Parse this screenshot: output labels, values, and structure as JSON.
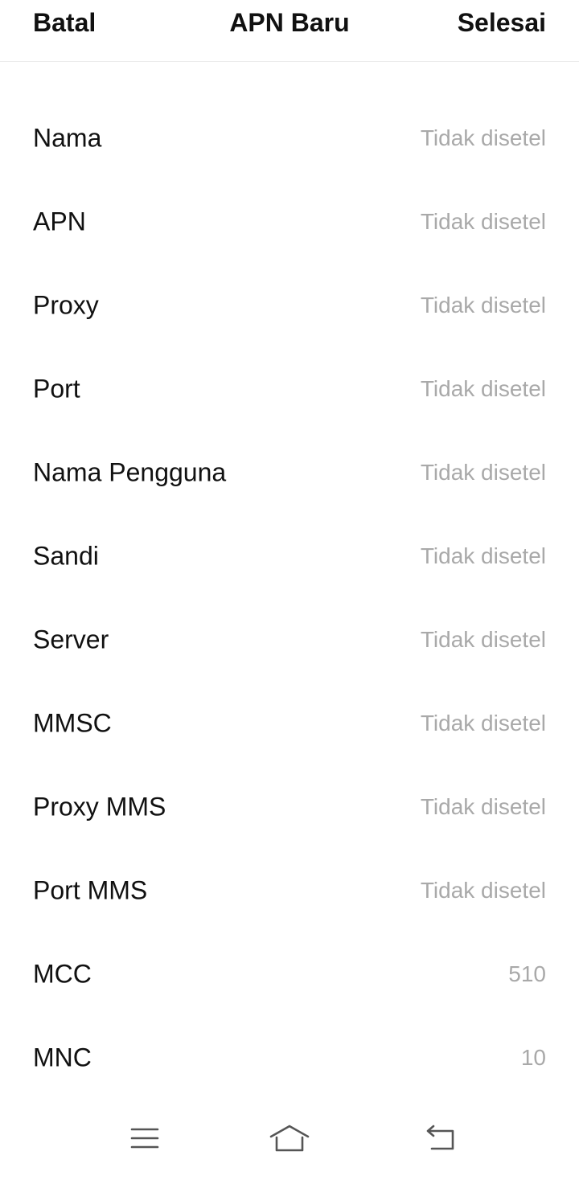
{
  "header": {
    "cancel_label": "Batal",
    "title": "APN Baru",
    "done_label": "Selesai"
  },
  "fields": [
    {
      "label": "Nama",
      "value": "Tidak disetel"
    },
    {
      "label": "APN",
      "value": "Tidak disetel"
    },
    {
      "label": "Proxy",
      "value": "Tidak disetel"
    },
    {
      "label": "Port",
      "value": "Tidak disetel"
    },
    {
      "label": "Nama Pengguna",
      "value": "Tidak disetel"
    },
    {
      "label": "Sandi",
      "value": "Tidak disetel"
    },
    {
      "label": "Server",
      "value": "Tidak disetel"
    },
    {
      "label": "MMSC",
      "value": "Tidak disetel"
    },
    {
      "label": "Proxy MMS",
      "value": "Tidak disetel"
    },
    {
      "label": "Port MMS",
      "value": "Tidak disetel"
    },
    {
      "label": "MCC",
      "value": "510"
    },
    {
      "label": "MNC",
      "value": "10"
    }
  ],
  "navbar": {
    "icons": [
      "menu-icon",
      "home-icon",
      "back-icon"
    ]
  },
  "colors": {
    "text": "#111111",
    "value_placeholder": "#a9a9a9",
    "nav_icon": "#555555"
  }
}
